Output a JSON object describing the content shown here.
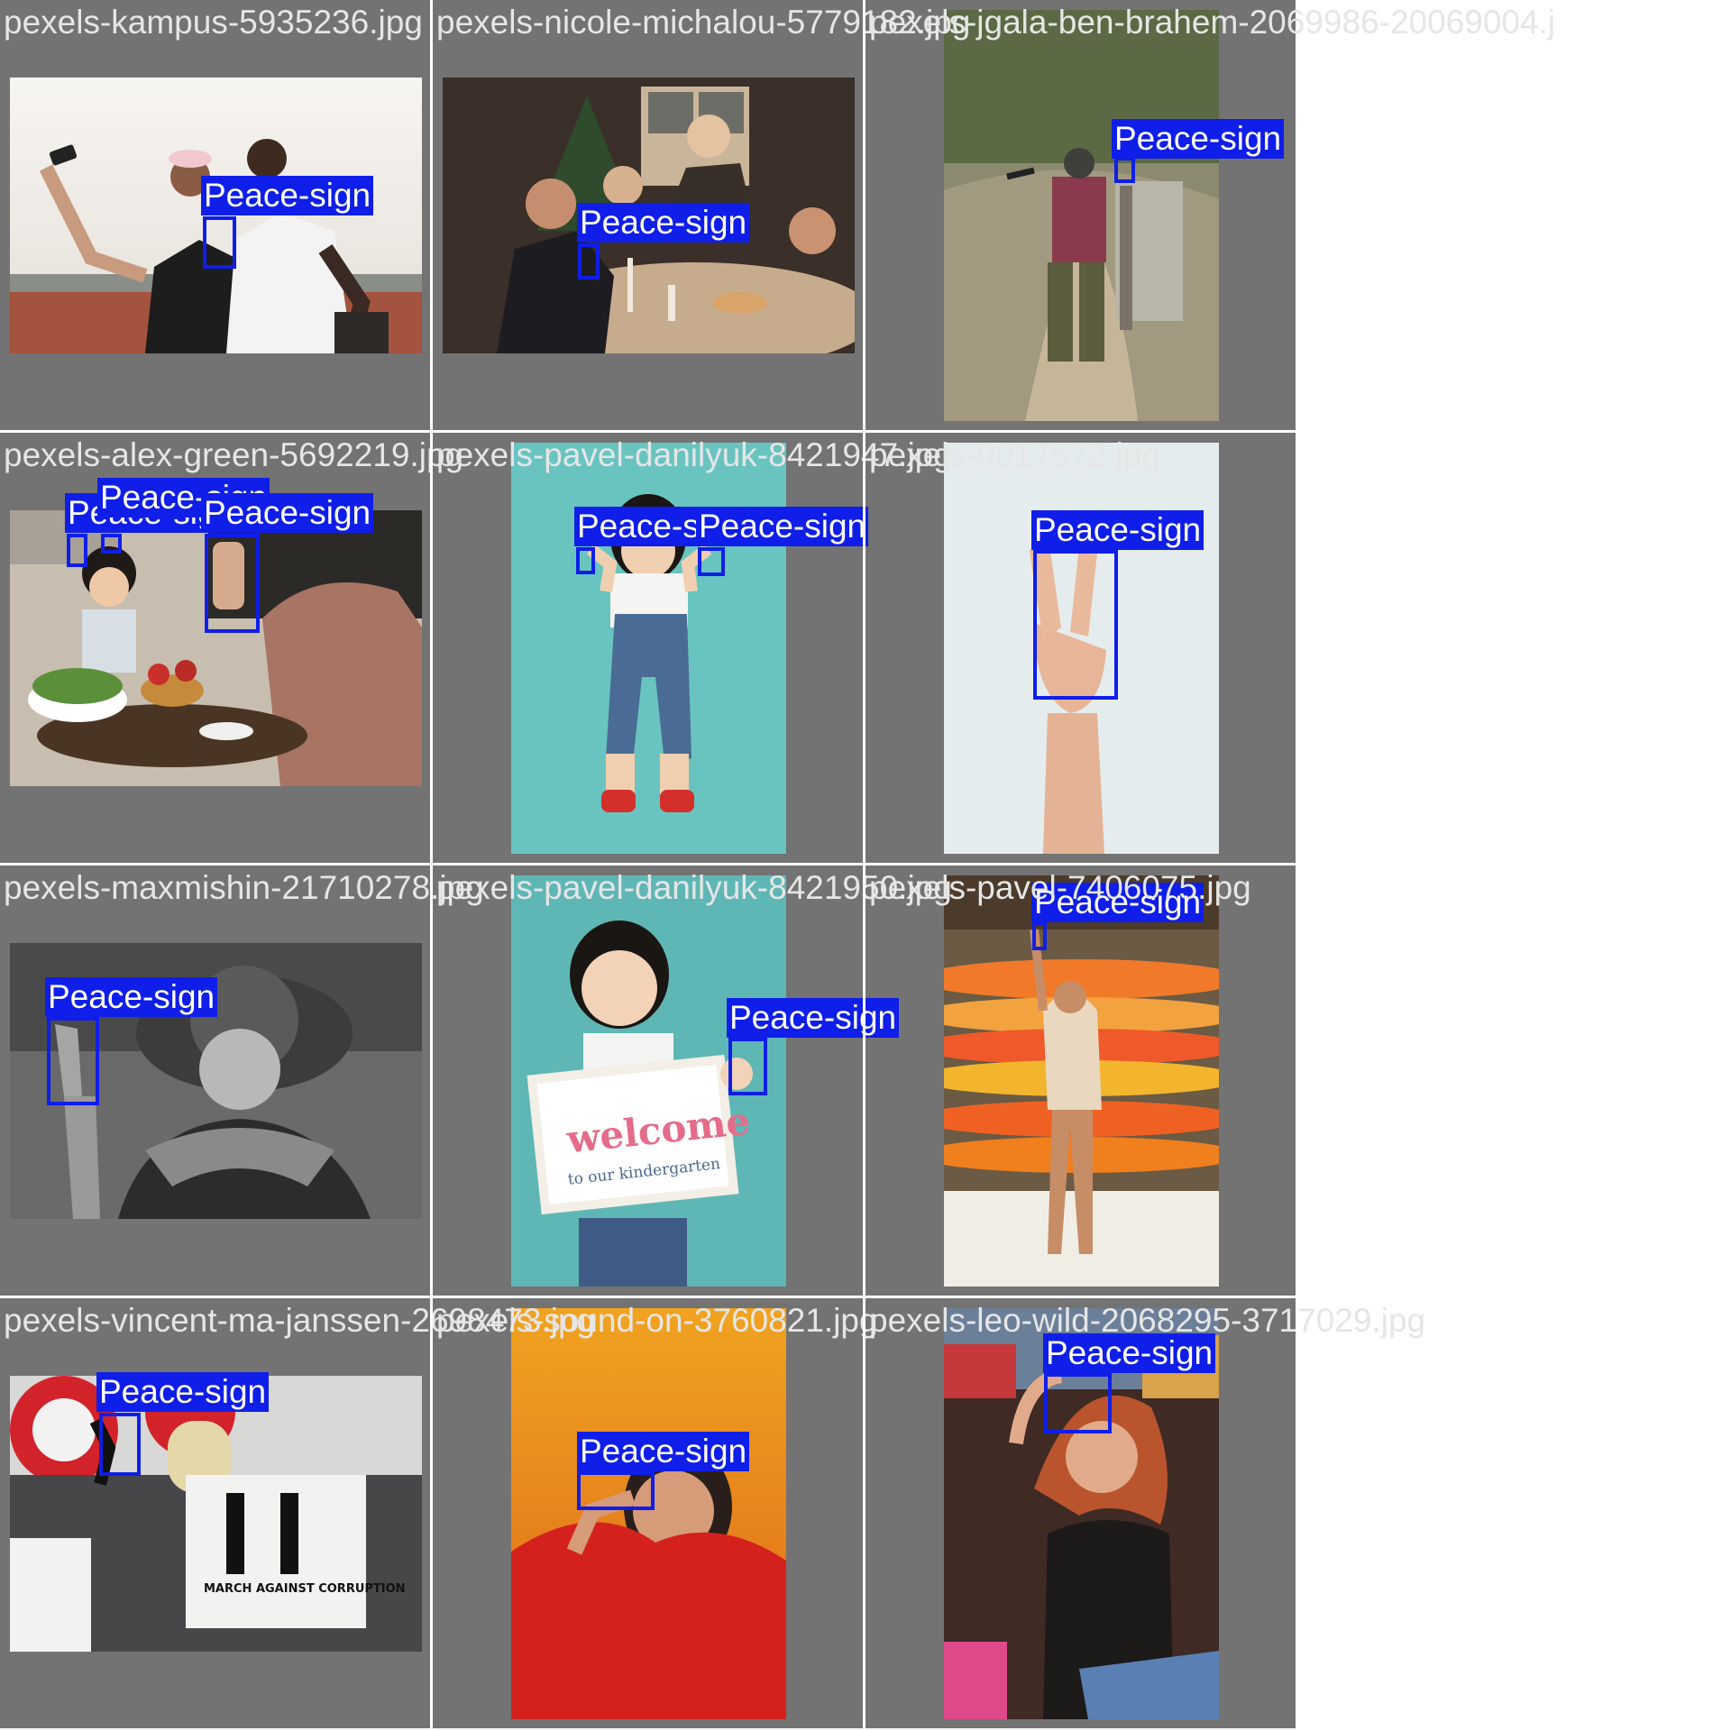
{
  "page": {
    "background": "#ffffff",
    "tile_background": "#737373",
    "box_color": "#0f1ee8"
  },
  "tiles": [
    {
      "file": "pexels-kampus-5935236.jpg",
      "detections": [
        "Peace-sign"
      ]
    },
    {
      "file": "pexels-nicole-michalou-5779182.jpg",
      "detections": [
        "Peace-sign"
      ]
    },
    {
      "file": "pexels-jgala-ben-brahem-2069986-20069004.j",
      "detections": [
        "Peace-sign"
      ]
    },
    {
      "file": "pexels-alex-green-5692219.jpg",
      "detections": [
        "Peace-sign",
        "Peace-sign",
        "Peace-sign"
      ]
    },
    {
      "file": "pexels-pavel-danilyuk-8421947.jpg",
      "detections": [
        "Peace-sign",
        "Peace-sign"
      ]
    },
    {
      "file": "pexels-9017572.jpg",
      "detections": [
        "Peace-sign"
      ]
    },
    {
      "file": "pexels-maxmishin-21710278.jpg",
      "detections": [
        "Peace-sign"
      ]
    },
    {
      "file": "pexels-pavel-danilyuk-8421950.jpg",
      "detections": [
        "Peace-sign"
      ]
    },
    {
      "file": "pexels-pavel-7406075.jpg",
      "detections": [
        "Peace-sign"
      ]
    },
    {
      "file": "pexels-vincent-ma-janssen-2698473.jpg",
      "detections": [
        "Peace-sign"
      ]
    },
    {
      "file": "pexels-sound-on-3760821.jpg",
      "detections": [
        "Peace-sign"
      ]
    },
    {
      "file": "pexels-leo-wild-2068295-3717029.jpg",
      "detections": [
        "Peace-sign"
      ]
    }
  ],
  "photo_text": {
    "sign_welcome": "welcome",
    "sign_kindergarten": "to our kindergarten",
    "sign_march": "MARCH AGAINST CORRUPTION"
  }
}
